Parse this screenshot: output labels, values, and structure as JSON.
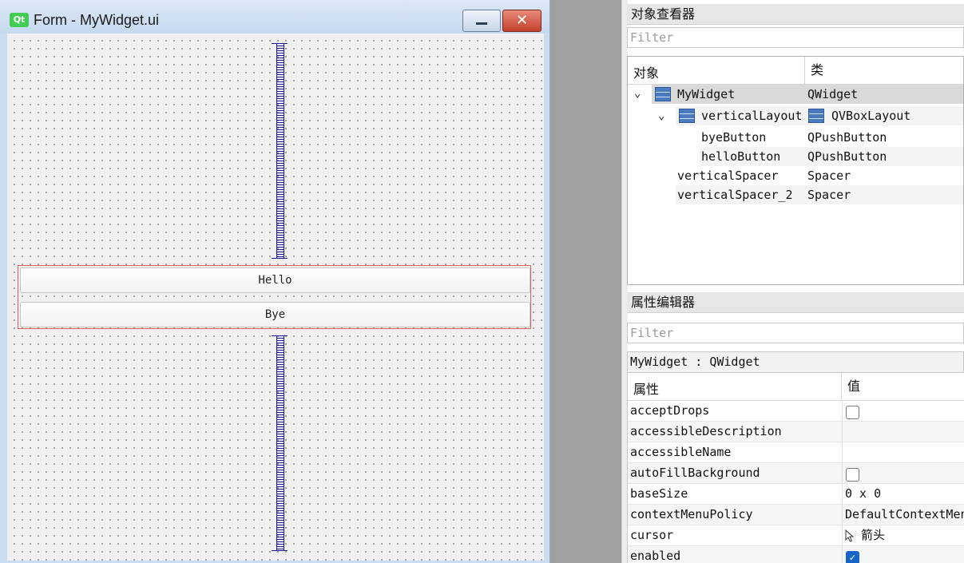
{
  "form": {
    "logo": "Qt",
    "title": "Form - MyWidget.ui",
    "minimize_icon": "minimize-icon",
    "close_icon": "close-icon",
    "close_glyph": "✕",
    "hello_label": "Hello",
    "bye_label": "Bye"
  },
  "object_inspector": {
    "title": "对象查看器",
    "filter_placeholder": "Filter",
    "col_object": "对象",
    "col_class": "类",
    "rows": [
      {
        "name": "MyWidget",
        "cls": "QWidget",
        "expanded": true
      },
      {
        "name": "verticalLayout",
        "cls": "QVBoxLayout",
        "expanded": true
      },
      {
        "name": "byeButton",
        "cls": "QPushButton"
      },
      {
        "name": "helloButton",
        "cls": "QPushButton"
      },
      {
        "name": "verticalSpacer",
        "cls": "Spacer"
      },
      {
        "name": "verticalSpacer_2",
        "cls": "Spacer"
      }
    ]
  },
  "property_editor": {
    "title": "属性编辑器",
    "filter_placeholder": "Filter",
    "class_bar": "MyWidget : QWidget",
    "col_property": "属性",
    "col_value": "值",
    "rows": [
      {
        "name": "acceptDrops",
        "type": "checkbox",
        "checked": false
      },
      {
        "name": "accessibleDescription",
        "value": ""
      },
      {
        "name": "accessibleName",
        "value": ""
      },
      {
        "name": "autoFillBackground",
        "type": "checkbox",
        "checked": false
      },
      {
        "name": "baseSize",
        "value": "0 x 0"
      },
      {
        "name": "contextMenuPolicy",
        "value": "DefaultContextMenu"
      },
      {
        "name": "cursor",
        "value": "箭头",
        "icon": "arrow-cursor-icon"
      },
      {
        "name": "enabled",
        "type": "checkbox",
        "checked": true
      }
    ]
  }
}
